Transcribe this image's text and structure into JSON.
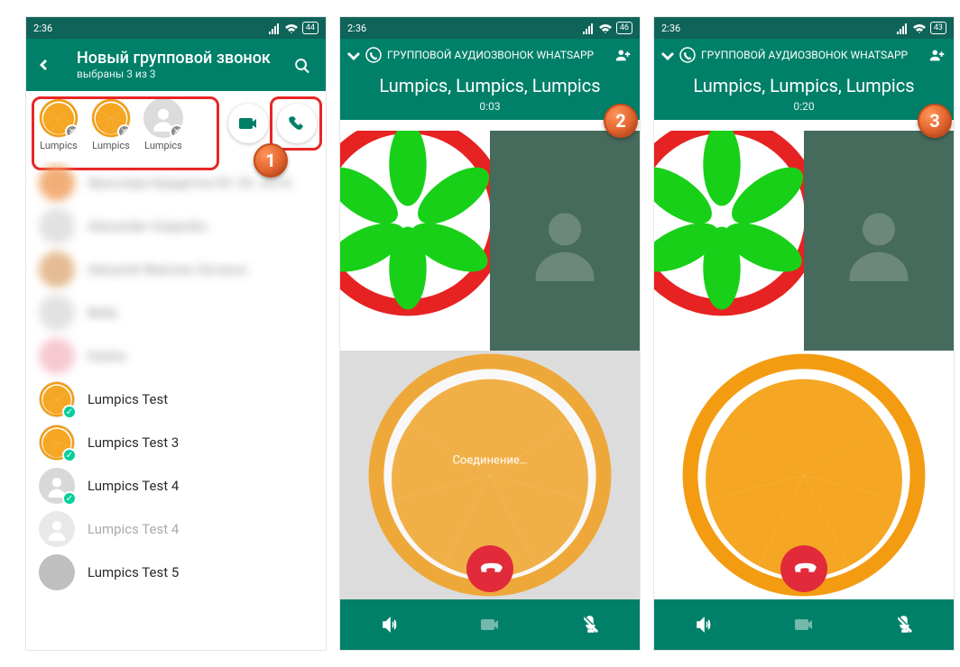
{
  "status": {
    "time": "2:36",
    "battery1": "44",
    "battery2": "46",
    "battery3": "43"
  },
  "colors": {
    "teal": "#008069",
    "red": "#e12b3a",
    "highlight": "#e82626",
    "badge": "#e2642e"
  },
  "screen1": {
    "title": "Новый групповой звонок",
    "subtitle": "выбраны 3 из 3",
    "selected": [
      {
        "name": "Lumpics",
        "avatar": "orange"
      },
      {
        "name": "Lumpics",
        "avatar": "orange"
      },
      {
        "name": "Lumpics",
        "avatar": "default"
      }
    ],
    "contacts_visible": [
      {
        "name": "Lumpics Test",
        "avatar": "orange",
        "checked": true
      },
      {
        "name": "Lumpics Test 3",
        "avatar": "orange",
        "checked": true
      },
      {
        "name": "Lumpics Test 4",
        "avatar": "default",
        "checked": true
      },
      {
        "name": "Lumpics Test 4",
        "avatar": "default",
        "checked": false
      },
      {
        "name": "Lumpics Test 5",
        "avatar": "photo",
        "checked": false
      }
    ],
    "contacts_blurred": [
      {
        "name": "Ярослава Кредитка 05. 03. 2018"
      },
      {
        "name": "Alexander Osipenko"
      },
      {
        "name": "Alexandr Beerose Луганск"
      },
      {
        "name": "Bella"
      },
      {
        "name": "Dasha"
      }
    ]
  },
  "call": {
    "top_label": "ГРУППОВОЙ АУДИОЗВОНОК WHATSAPP",
    "names": "Lumpics, Lumpics, Lumpics",
    "connecting_label": "Соединение…",
    "time_s2": "0:03",
    "time_s3": "0:20"
  },
  "badges": {
    "b1": "1",
    "b2": "2",
    "b3": "3"
  }
}
